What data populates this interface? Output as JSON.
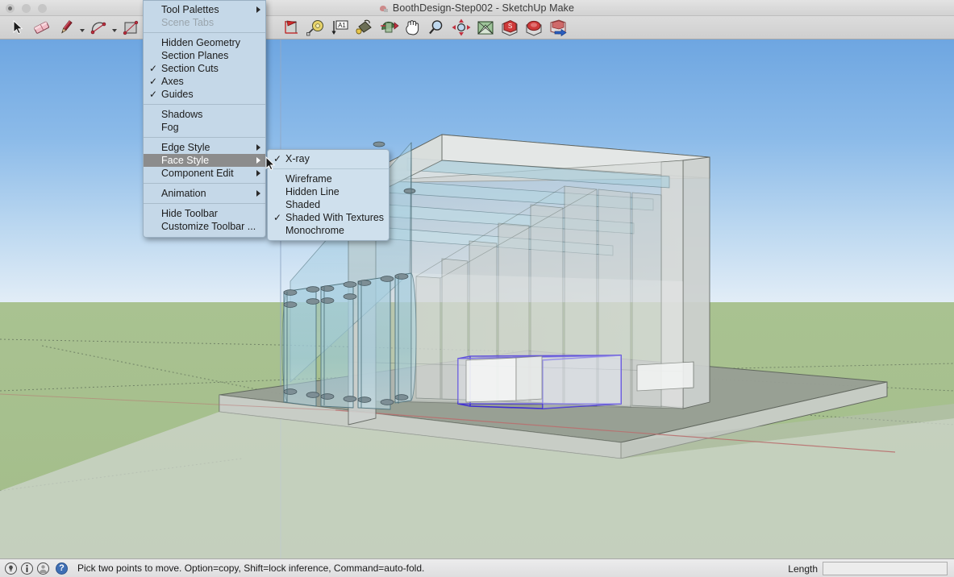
{
  "window": {
    "title": "BoothDesign-Step002 - SketchUp Make",
    "doc_icon": "sketchup-document-icon",
    "controls": {
      "close": "close-window-button",
      "minimize": "minimize-window-button",
      "maximize": "maximize-window-button"
    }
  },
  "toolbar": {
    "tools": [
      {
        "name": "select-tool",
        "icon": "arrow-cursor-icon",
        "caret": false
      },
      {
        "name": "eraser-tool",
        "icon": "eraser-icon",
        "caret": false
      },
      {
        "name": "line-tool",
        "icon": "pencil-icon",
        "caret": true
      },
      {
        "name": "arc-tool",
        "icon": "arc-icon",
        "caret": true
      },
      {
        "name": "rectangle-tool",
        "icon": "rectangle-icon",
        "caret": true
      },
      {
        "name": "pushpull-tool",
        "icon": "pushpull-icon",
        "caret": false
      },
      {
        "name": "move-tool",
        "icon": "move-arrows-icon",
        "caret": false
      },
      {
        "name": "tape-measure-tool",
        "icon": "tape-measure-icon",
        "caret": false
      },
      {
        "name": "dimension-tool",
        "icon": "dimension-a1-icon",
        "caret": false
      },
      {
        "name": "paint-bucket-tool",
        "icon": "paint-bucket-icon",
        "caret": false
      },
      {
        "name": "follow-me-tool",
        "icon": "follow-me-icon",
        "caret": false
      },
      {
        "name": "orbit-tool",
        "icon": "hand-orbit-icon",
        "caret": false
      },
      {
        "name": "zoom-tool",
        "icon": "magnifier-icon",
        "caret": false
      },
      {
        "name": "zoom-extents-tool",
        "icon": "zoom-extents-icon",
        "caret": false
      },
      {
        "name": "position-camera-tool",
        "icon": "position-camera-icon",
        "caret": false
      },
      {
        "name": "3d-warehouse-get-tool",
        "icon": "warehouse-get-icon",
        "caret": false
      },
      {
        "name": "3d-warehouse-share-tool",
        "icon": "warehouse-share-icon",
        "caret": false
      },
      {
        "name": "export-tool",
        "icon": "export-arrow-icon",
        "caret": false
      }
    ]
  },
  "view_menu": {
    "items": [
      {
        "label": "Tool Palettes",
        "checked": false,
        "submenu": true,
        "disabled": false,
        "highlighted": false
      },
      {
        "label": "Scene Tabs",
        "checked": false,
        "submenu": false,
        "disabled": true,
        "highlighted": false
      },
      {
        "separator": true
      },
      {
        "label": "Hidden Geometry",
        "checked": false,
        "submenu": false,
        "disabled": false,
        "highlighted": false
      },
      {
        "label": "Section Planes",
        "checked": false,
        "submenu": false,
        "disabled": false,
        "highlighted": false
      },
      {
        "label": "Section Cuts",
        "checked": true,
        "submenu": false,
        "disabled": false,
        "highlighted": false
      },
      {
        "label": "Axes",
        "checked": true,
        "submenu": false,
        "disabled": false,
        "highlighted": false
      },
      {
        "label": "Guides",
        "checked": true,
        "submenu": false,
        "disabled": false,
        "highlighted": false
      },
      {
        "separator": true
      },
      {
        "label": "Shadows",
        "checked": false,
        "submenu": false,
        "disabled": false,
        "highlighted": false
      },
      {
        "label": "Fog",
        "checked": false,
        "submenu": false,
        "disabled": false,
        "highlighted": false
      },
      {
        "separator": true
      },
      {
        "label": "Edge Style",
        "checked": false,
        "submenu": true,
        "disabled": false,
        "highlighted": false
      },
      {
        "label": "Face Style",
        "checked": false,
        "submenu": true,
        "disabled": false,
        "highlighted": true
      },
      {
        "label": "Component Edit",
        "checked": false,
        "submenu": true,
        "disabled": false,
        "highlighted": false
      },
      {
        "separator": true
      },
      {
        "label": "Animation",
        "checked": false,
        "submenu": true,
        "disabled": false,
        "highlighted": false
      },
      {
        "separator": true
      },
      {
        "label": "Hide Toolbar",
        "checked": false,
        "submenu": false,
        "disabled": false,
        "highlighted": false
      },
      {
        "label": "Customize Toolbar ...",
        "checked": false,
        "submenu": false,
        "disabled": false,
        "highlighted": false
      }
    ]
  },
  "face_style_menu": {
    "items": [
      {
        "label": "X-ray",
        "checked": true
      },
      {
        "separator": true
      },
      {
        "label": "Wireframe",
        "checked": false
      },
      {
        "label": "Hidden Line",
        "checked": false
      },
      {
        "label": "Shaded",
        "checked": false
      },
      {
        "label": "Shaded With Textures",
        "checked": true
      },
      {
        "label": "Monochrome",
        "checked": false
      }
    ]
  },
  "statusbar": {
    "icons": [
      {
        "name": "tip-lightbulb-icon"
      },
      {
        "name": "info-icon"
      },
      {
        "name": "account-person-icon"
      }
    ],
    "help_icon_label": "?",
    "message": "Pick two points to move.  Option=copy, Shift=lock inference, Command=auto-fold.",
    "measurement_label": "Length",
    "measurement_value": "",
    "measurement_placeholder": ""
  },
  "viewport": {
    "name": "3d-model-viewport",
    "scene_description": "Glass-walled exhibition booth model shown in X-ray face style",
    "face_style": "X-ray",
    "colors": {
      "sky_top": "#6ea8e2",
      "sky_horizon": "#dfeaf6",
      "ground_green": "#a6bf8c",
      "platform_top": "#9ea59b",
      "platform_side": "#d3d8d1",
      "glass_blue": "#9cc6d8",
      "wall_gray": "#c9cccb",
      "selection_blue": "#3a27d6",
      "axis_red": "#b36b6b",
      "axis_blue": "#8fa7c4",
      "guide_dash": "#5c6b57"
    },
    "cursor": "move-tool-cursor-arrow"
  }
}
